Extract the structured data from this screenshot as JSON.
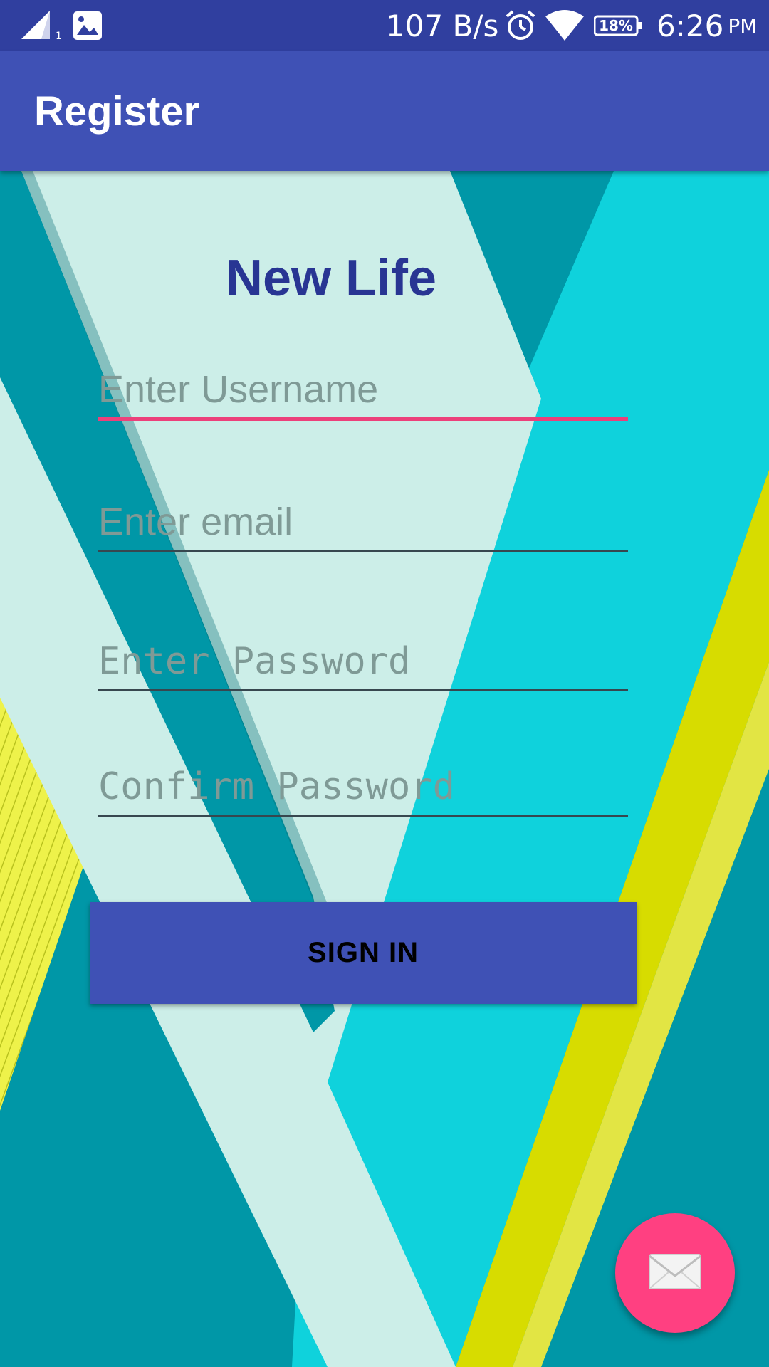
{
  "status_bar": {
    "net_speed": "107 B/s",
    "battery": "18%",
    "time": "6:26",
    "ampm": "PM",
    "sim_slot": "1"
  },
  "app_bar": {
    "title": "Register"
  },
  "form": {
    "brand_title": "New Life",
    "username_placeholder": "Enter Username",
    "email_placeholder": "Enter email",
    "password_placeholder": "Enter Password",
    "confirm_password_placeholder": "Confirm Password",
    "submit_label": "SIGN IN"
  },
  "fab": {
    "icon": "mail-icon"
  },
  "colors": {
    "primary": "#3f51b5",
    "primary_dark": "#303f9f",
    "accent": "#ff4081",
    "title": "#283593"
  }
}
